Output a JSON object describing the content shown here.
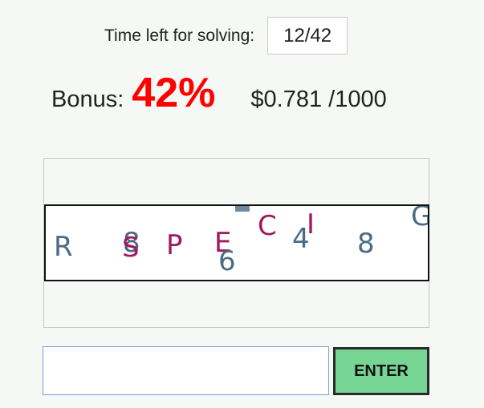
{
  "timer": {
    "label": "Time left for solving:",
    "value": "12/42"
  },
  "bonus": {
    "label": "Bonus:",
    "value": "42%",
    "value_color": "#ff0000"
  },
  "earnings": {
    "text": "$0.781 /1000"
  },
  "captcha": {
    "glyphs": [
      "R",
      "8",
      "S",
      "P",
      "E",
      "6",
      "C",
      "4",
      "I",
      "8",
      "G"
    ]
  },
  "answer": {
    "value": "",
    "placeholder": ""
  },
  "enter_button": {
    "label": "ENTER",
    "color": "#77d593"
  }
}
